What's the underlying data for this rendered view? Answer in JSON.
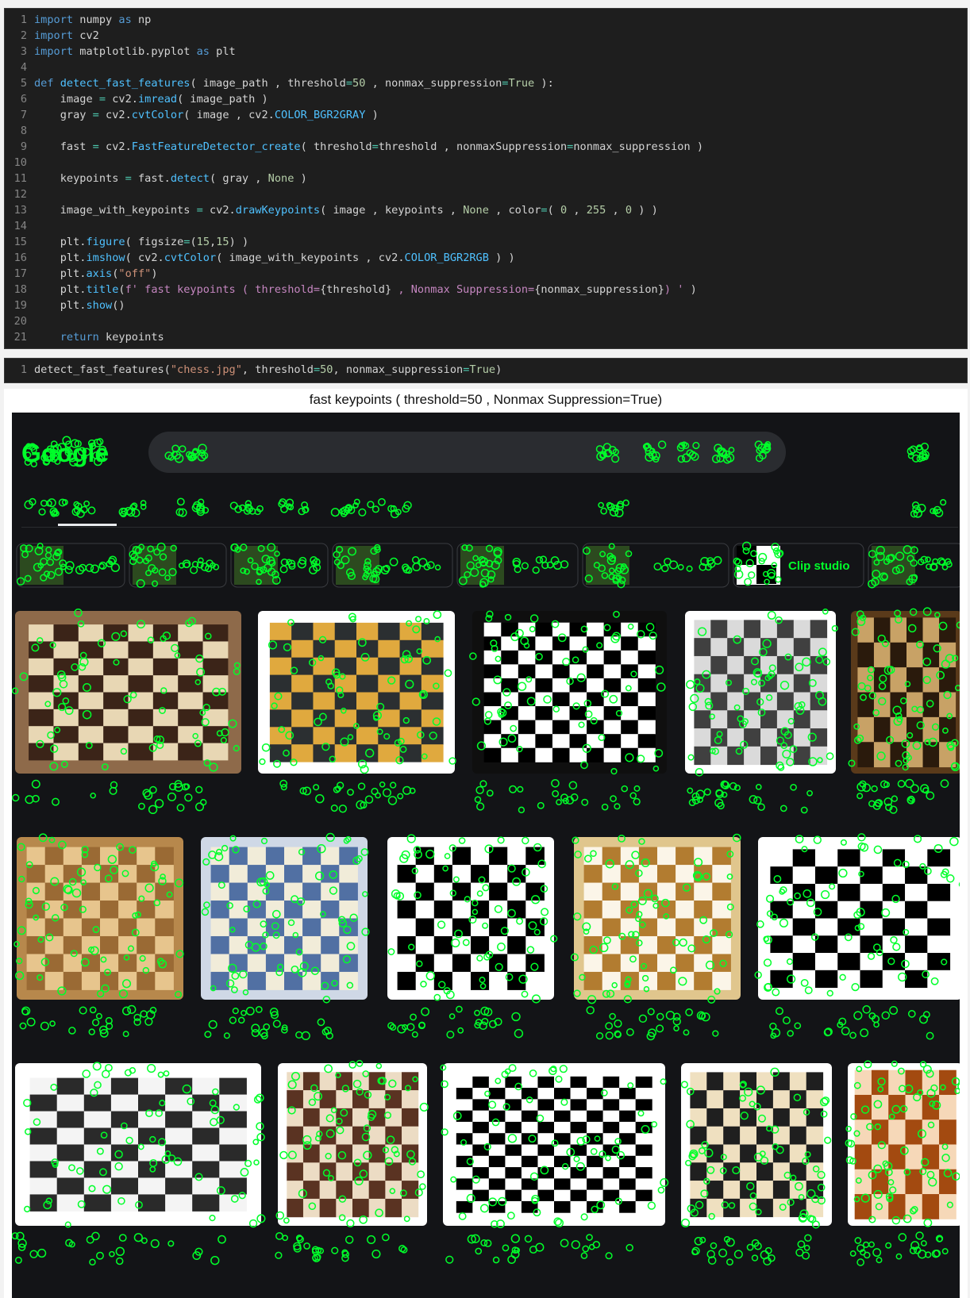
{
  "code_cell": {
    "lines": [
      {
        "n": "1",
        "tokens": [
          [
            "kw",
            "import"
          ],
          [
            "op",
            " numpy "
          ],
          [
            "kw",
            "as"
          ],
          [
            "op",
            " np"
          ]
        ]
      },
      {
        "n": "2",
        "tokens": [
          [
            "kw",
            "import"
          ],
          [
            "op",
            " cv2"
          ]
        ]
      },
      {
        "n": "3",
        "tokens": [
          [
            "kw",
            "import"
          ],
          [
            "op",
            " matplotlib.pyplot "
          ],
          [
            "kw",
            "as"
          ],
          [
            "op",
            " plt"
          ]
        ]
      },
      {
        "n": "4",
        "tokens": []
      },
      {
        "n": "5",
        "tokens": [
          [
            "kw",
            "def"
          ],
          [
            "op",
            " "
          ],
          [
            "fn2",
            "detect_fast_features"
          ],
          [
            "op",
            "( image_path , threshold"
          ],
          [
            "c2",
            "="
          ],
          [
            "num",
            "50"
          ],
          [
            "op",
            " , nonmax_suppression"
          ],
          [
            "c2",
            "="
          ],
          [
            "num",
            "True"
          ],
          [
            "op",
            " ):"
          ]
        ]
      },
      {
        "n": "6",
        "tokens": [
          [
            "op",
            "    image "
          ],
          [
            "c2",
            "="
          ],
          [
            "op",
            " cv2."
          ],
          [
            "fn2",
            "imread"
          ],
          [
            "op",
            "( image_path )"
          ]
        ]
      },
      {
        "n": "7",
        "tokens": [
          [
            "op",
            "    gray "
          ],
          [
            "c2",
            "="
          ],
          [
            "op",
            " cv2."
          ],
          [
            "fn2",
            "cvtColor"
          ],
          [
            "op",
            "( image , cv2."
          ],
          [
            "fn2",
            "COLOR_BGR2GRAY"
          ],
          [
            "op",
            " )"
          ]
        ]
      },
      {
        "n": "8",
        "tokens": []
      },
      {
        "n": "9",
        "tokens": [
          [
            "op",
            "    fast "
          ],
          [
            "c2",
            "="
          ],
          [
            "op",
            " cv2."
          ],
          [
            "fn2",
            "FastFeatureDetector_create"
          ],
          [
            "op",
            "( threshold"
          ],
          [
            "c2",
            "="
          ],
          [
            "op",
            "threshold , nonmaxSuppression"
          ],
          [
            "c2",
            "="
          ],
          [
            "op",
            "nonmax_suppression )"
          ]
        ]
      },
      {
        "n": "10",
        "tokens": []
      },
      {
        "n": "11",
        "tokens": [
          [
            "op",
            "    keypoints "
          ],
          [
            "c2",
            "="
          ],
          [
            "op",
            " fast."
          ],
          [
            "fn2",
            "detect"
          ],
          [
            "op",
            "( gray , "
          ],
          [
            "num",
            "None"
          ],
          [
            "op",
            " )"
          ]
        ]
      },
      {
        "n": "12",
        "tokens": []
      },
      {
        "n": "13",
        "tokens": [
          [
            "op",
            "    image_with_keypoints "
          ],
          [
            "c2",
            "="
          ],
          [
            "op",
            " cv2."
          ],
          [
            "fn2",
            "drawKeypoints"
          ],
          [
            "op",
            "( image , keypoints , "
          ],
          [
            "num",
            "None"
          ],
          [
            "op",
            " , color"
          ],
          [
            "c2",
            "="
          ],
          [
            "op",
            "( "
          ],
          [
            "num",
            "0"
          ],
          [
            "op",
            " , "
          ],
          [
            "num",
            "255"
          ],
          [
            "op",
            " , "
          ],
          [
            "num",
            "0"
          ],
          [
            "op",
            " ) )"
          ]
        ]
      },
      {
        "n": "14",
        "tokens": []
      },
      {
        "n": "15",
        "tokens": [
          [
            "op",
            "    plt."
          ],
          [
            "fn2",
            "figure"
          ],
          [
            "op",
            "( figsize"
          ],
          [
            "c2",
            "="
          ],
          [
            "op",
            "("
          ],
          [
            "num",
            "15"
          ],
          [
            "op",
            ","
          ],
          [
            "num",
            "15"
          ],
          [
            "op",
            ") )"
          ]
        ]
      },
      {
        "n": "16",
        "tokens": [
          [
            "op",
            "    plt."
          ],
          [
            "fn2",
            "imshow"
          ],
          [
            "op",
            "( cv2."
          ],
          [
            "fn2",
            "cvtColor"
          ],
          [
            "op",
            "( image_with_keypoints , cv2."
          ],
          [
            "fn2",
            "COLOR_BGR2RGB"
          ],
          [
            "op",
            " ) )"
          ]
        ]
      },
      {
        "n": "17",
        "tokens": [
          [
            "op",
            "    plt."
          ],
          [
            "fn2",
            "axis"
          ],
          [
            "op",
            "("
          ],
          [
            "str",
            "\"off\""
          ],
          [
            "op",
            ")"
          ]
        ]
      },
      {
        "n": "18",
        "tokens": [
          [
            "op",
            "    plt."
          ],
          [
            "fn2",
            "title"
          ],
          [
            "op",
            "("
          ],
          [
            "c1",
            "f' fast keypoints ( threshold="
          ],
          [
            "op",
            "{threshold}"
          ],
          [
            "c1",
            " , Nonmax Suppression="
          ],
          [
            "op",
            "{nonmax_suppression}"
          ],
          [
            "c1",
            ") '"
          ],
          [
            "op",
            " )"
          ]
        ]
      },
      {
        "n": "19",
        "tokens": [
          [
            "op",
            "    plt."
          ],
          [
            "fn2",
            "show"
          ],
          [
            "op",
            "()"
          ]
        ]
      },
      {
        "n": "20",
        "tokens": []
      },
      {
        "n": "21",
        "tokens": [
          [
            "op",
            "    "
          ],
          [
            "kw",
            "return"
          ],
          [
            "op",
            " keypoints"
          ]
        ]
      }
    ]
  },
  "call_cell": {
    "lines": [
      {
        "n": "1",
        "tokens": [
          [
            "op",
            "detect_fast_features("
          ],
          [
            "str",
            "\"chess.jpg\""
          ],
          [
            "op",
            ", threshold"
          ],
          [
            "c2",
            "="
          ],
          [
            "num",
            "50"
          ],
          [
            "op",
            ", nonmax_suppression"
          ],
          [
            "c2",
            "="
          ],
          [
            "num",
            "True"
          ],
          [
            "op",
            ")"
          ]
        ]
      }
    ]
  },
  "output": {
    "title": "fast keypoints ( threshold=50 , Nonmax Suppression=True)",
    "search_logo": "Google",
    "chip_clip_label": "Clip studio"
  },
  "colors": {
    "keypoint": "#00ff2a",
    "background": "#131417",
    "editor": "#1e1e1e"
  }
}
